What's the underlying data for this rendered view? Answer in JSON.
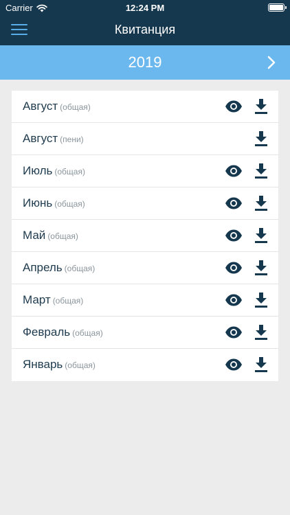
{
  "status_bar": {
    "carrier": "Carrier",
    "time": "12:24 PM",
    "battery_level": 1.0
  },
  "header": {
    "title": "Квитанция",
    "menu_icon": "hamburger-menu-icon"
  },
  "year_selector": {
    "year": "2019",
    "next_icon": "chevron-right-icon"
  },
  "colors": {
    "header_bg": "#16384f",
    "year_bar_bg": "#6bb8ef",
    "icon": "#16384f",
    "page_bg": "#ececec"
  },
  "receipts": [
    {
      "month": "Август",
      "type": "(общая)",
      "has_view": true,
      "has_download": true
    },
    {
      "month": "Август",
      "type": "(пени)",
      "has_view": false,
      "has_download": true
    },
    {
      "month": "Июль",
      "type": "(общая)",
      "has_view": true,
      "has_download": true
    },
    {
      "month": "Июнь",
      "type": "(общая)",
      "has_view": true,
      "has_download": true
    },
    {
      "month": "Май",
      "type": "(общая)",
      "has_view": true,
      "has_download": true
    },
    {
      "month": "Апрель",
      "type": "(общая)",
      "has_view": true,
      "has_download": true
    },
    {
      "month": "Март",
      "type": "(общая)",
      "has_view": true,
      "has_download": true
    },
    {
      "month": "Февраль",
      "type": "(общая)",
      "has_view": true,
      "has_download": true
    },
    {
      "month": "Январь",
      "type": "(общая)",
      "has_view": true,
      "has_download": true
    }
  ]
}
